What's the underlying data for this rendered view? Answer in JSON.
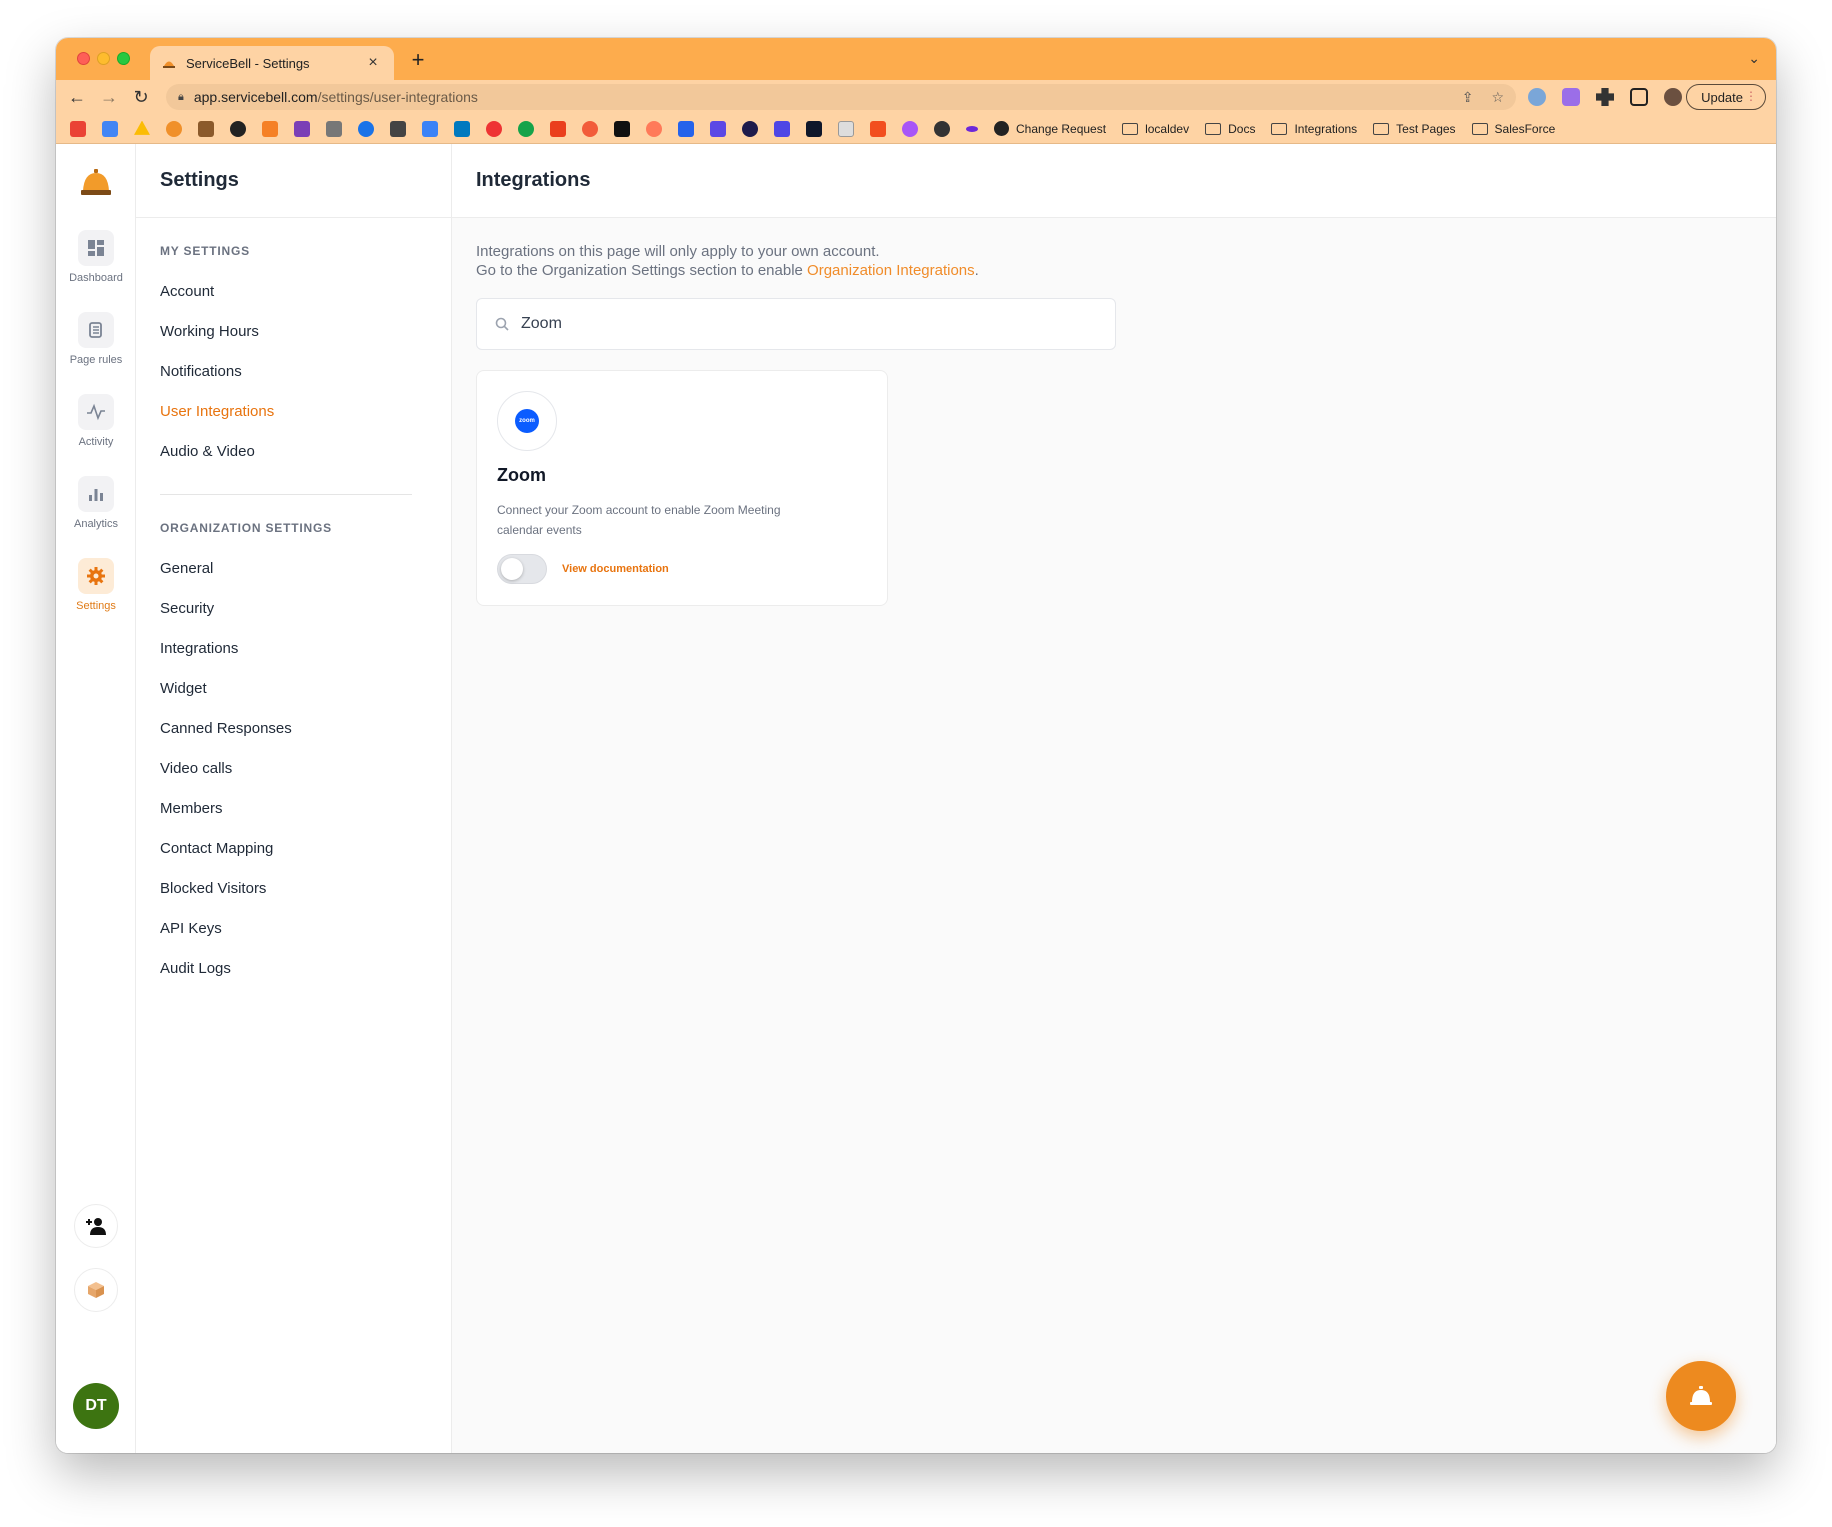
{
  "browser": {
    "tab_title": "ServiceBell - Settings",
    "url_host": "app.servicebell.com",
    "url_path": "/settings/user-integrations",
    "update_label": "Update",
    "bookmarks": [
      "Change Request",
      "localdev",
      "Docs",
      "Integrations",
      "Test Pages",
      "SalesForce"
    ]
  },
  "rail": {
    "items": [
      {
        "label": "Dashboard",
        "icon": "dashboard-icon"
      },
      {
        "label": "Page rules",
        "icon": "page-rules-icon"
      },
      {
        "label": "Activity",
        "icon": "activity-icon"
      },
      {
        "label": "Analytics",
        "icon": "analytics-icon"
      },
      {
        "label": "Settings",
        "icon": "gear-icon"
      }
    ],
    "avatar_initials": "DT"
  },
  "settings_nav": {
    "title": "Settings",
    "my_settings_title": "MY SETTINGS",
    "my_settings": [
      "Account",
      "Working Hours",
      "Notifications",
      "User Integrations",
      "Audio & Video"
    ],
    "org_settings_title": "ORGANIZATION SETTINGS",
    "org_settings": [
      "General",
      "Security",
      "Integrations",
      "Widget",
      "Canned Responses",
      "Video calls",
      "Members",
      "Contact Mapping",
      "Blocked Visitors",
      "API Keys",
      "Audit Logs"
    ]
  },
  "main": {
    "title": "Integrations",
    "intro_line1": "Integrations on this page will only apply to your own account.",
    "intro_line2_prefix": "Go to the Organization Settings section to enable ",
    "intro_link": "Organization Integrations",
    "intro_line2_suffix": ".",
    "search_value": "Zoom",
    "card": {
      "logo_text": "zoom",
      "title": "Zoom",
      "description": "Connect your Zoom account to enable Zoom Meeting calendar events",
      "enabled": false,
      "doc_link": "View documentation"
    }
  },
  "colors": {
    "brand_orange": "#ed8a1f",
    "chrome_orange": "#fdac4d",
    "active_link": "#e8740f",
    "avatar_green": "#3d7411",
    "zoom_blue": "#0b5cff"
  }
}
